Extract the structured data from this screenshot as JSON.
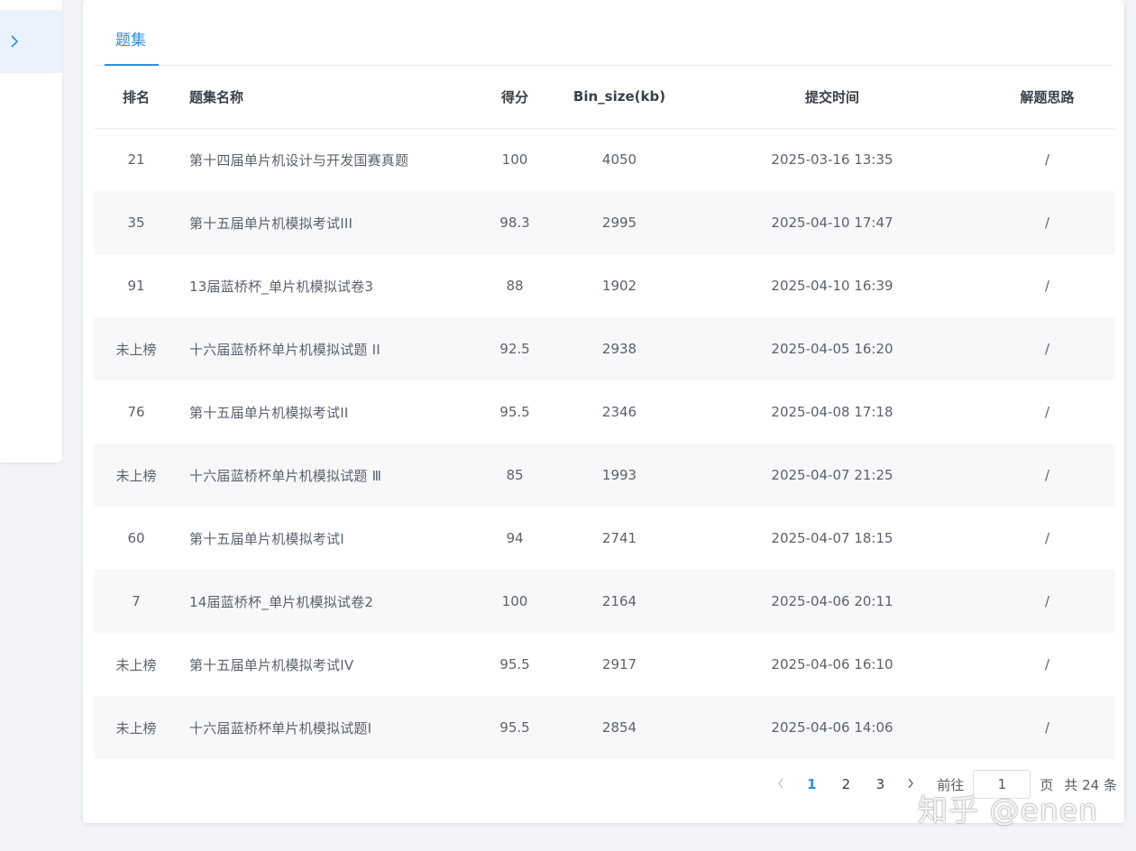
{
  "tabs": [
    {
      "label": "题集"
    }
  ],
  "table": {
    "headers": {
      "rank": "排名",
      "name": "题集名称",
      "score": "得分",
      "bin_size": "Bin_size(kb)",
      "submit_time": "提交时间",
      "solution": "解题思路"
    },
    "rows": [
      {
        "rank": "21",
        "name": "第十四届单片机设计与开发国赛真题",
        "score": "100",
        "bin_size": "4050",
        "submit_time": "2025-03-16 13:35",
        "solution": "/"
      },
      {
        "rank": "35",
        "name": "第十五届单片机模拟考试III",
        "score": "98.3",
        "bin_size": "2995",
        "submit_time": "2025-04-10 17:47",
        "solution": "/"
      },
      {
        "rank": "91",
        "name": "13届蓝桥杯_单片机模拟试卷3",
        "score": "88",
        "bin_size": "1902",
        "submit_time": "2025-04-10 16:39",
        "solution": "/"
      },
      {
        "rank": "未上榜",
        "name": "十六届蓝桥杯单片机模拟试题 II",
        "score": "92.5",
        "bin_size": "2938",
        "submit_time": "2025-04-05 16:20",
        "solution": "/"
      },
      {
        "rank": "76",
        "name": "第十五届单片机模拟考试II",
        "score": "95.5",
        "bin_size": "2346",
        "submit_time": "2025-04-08 17:18",
        "solution": "/"
      },
      {
        "rank": "未上榜",
        "name": "十六届蓝桥杯单片机模拟试题 Ⅲ",
        "score": "85",
        "bin_size": "1993",
        "submit_time": "2025-04-07 21:25",
        "solution": "/"
      },
      {
        "rank": "60",
        "name": "第十五届单片机模拟考试I",
        "score": "94",
        "bin_size": "2741",
        "submit_time": "2025-04-07 18:15",
        "solution": "/"
      },
      {
        "rank": "7",
        "name": "14届蓝桥杯_单片机模拟试卷2",
        "score": "100",
        "bin_size": "2164",
        "submit_time": "2025-04-06 20:11",
        "solution": "/"
      },
      {
        "rank": "未上榜",
        "name": "第十五届单片机模拟考试IV",
        "score": "95.5",
        "bin_size": "2917",
        "submit_time": "2025-04-06 16:10",
        "solution": "/"
      },
      {
        "rank": "未上榜",
        "name": "十六届蓝桥杯单片机模拟试题I",
        "score": "95.5",
        "bin_size": "2854",
        "submit_time": "2025-04-06 14:06",
        "solution": "/"
      }
    ]
  },
  "pagination": {
    "prev_icon": "chevron-left-icon",
    "next_icon": "chevron-right-icon",
    "pages": [
      "1",
      "2",
      "3"
    ],
    "current_page": "1",
    "goto_label": "前往",
    "goto_value": "1",
    "page_unit": "页",
    "total_label": "共 24 条"
  },
  "sidebar": {
    "expand_icon": "chevron-right-icon"
  },
  "watermark": "知乎 @enen",
  "colors": {
    "accent": "#2c8fd9",
    "stripe": "#f7f8fa",
    "background": "#f3f4f7"
  }
}
